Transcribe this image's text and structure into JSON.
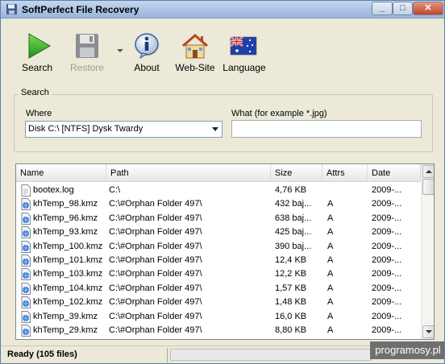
{
  "window": {
    "title": "SoftPerfect File Recovery"
  },
  "toolbar": {
    "search_label": "Search",
    "restore_label": "Restore",
    "about_label": "About",
    "website_label": "Web-Site",
    "language_label": "Language"
  },
  "search": {
    "group_label": "Search",
    "where_label": "Where",
    "where_value": "Disk C:\\ [NTFS] Dysk Twardy",
    "what_label": "What (for example *.jpg)",
    "what_value": ""
  },
  "list": {
    "columns": [
      "Name",
      "Path",
      "Size",
      "Attrs",
      "Date"
    ],
    "rows": [
      {
        "name": "bootex.log",
        "path": "C:\\",
        "size": "4,76 KB",
        "attrs": "",
        "date": "2009-...",
        "icon": "text-file-icon"
      },
      {
        "name": "khTemp_98.kmz",
        "path": "C:\\#Orphan Folder 497\\",
        "size": "432 baj...",
        "attrs": "A",
        "date": "2009-...",
        "icon": "kmz-file-icon"
      },
      {
        "name": "khTemp_96.kmz",
        "path": "C:\\#Orphan Folder 497\\",
        "size": "638 baj...",
        "attrs": "A",
        "date": "2009-...",
        "icon": "kmz-file-icon"
      },
      {
        "name": "khTemp_93.kmz",
        "path": "C:\\#Orphan Folder 497\\",
        "size": "425 baj...",
        "attrs": "A",
        "date": "2009-...",
        "icon": "kmz-file-icon"
      },
      {
        "name": "khTemp_100.kmz",
        "path": "C:\\#Orphan Folder 497\\",
        "size": "390 baj...",
        "attrs": "A",
        "date": "2009-...",
        "icon": "kmz-file-icon"
      },
      {
        "name": "khTemp_101.kmz",
        "path": "C:\\#Orphan Folder 497\\",
        "size": "12,4 KB",
        "attrs": "A",
        "date": "2009-...",
        "icon": "kmz-file-icon"
      },
      {
        "name": "khTemp_103.kmz",
        "path": "C:\\#Orphan Folder 497\\",
        "size": "12,2 KB",
        "attrs": "A",
        "date": "2009-...",
        "icon": "kmz-file-icon"
      },
      {
        "name": "khTemp_104.kmz",
        "path": "C:\\#Orphan Folder 497\\",
        "size": "1,57 KB",
        "attrs": "A",
        "date": "2009-...",
        "icon": "kmz-file-icon"
      },
      {
        "name": "khTemp_102.kmz",
        "path": "C:\\#Orphan Folder 497\\",
        "size": "1,48 KB",
        "attrs": "A",
        "date": "2009-...",
        "icon": "kmz-file-icon"
      },
      {
        "name": "khTemp_39.kmz",
        "path": "C:\\#Orphan Folder 497\\",
        "size": "16,0 KB",
        "attrs": "A",
        "date": "2009-...",
        "icon": "kmz-file-icon"
      },
      {
        "name": "khTemp_29.kmz",
        "path": "C:\\#Orphan Folder 497\\",
        "size": "8,80 KB",
        "attrs": "A",
        "date": "2009-...",
        "icon": "kmz-file-icon"
      }
    ]
  },
  "status": {
    "text": "Ready (105 files)",
    "progress": 0
  },
  "watermark": "programosy.pl",
  "colors": {
    "accent": "#2f9e2f",
    "titlebar": "#a9c2e2"
  }
}
